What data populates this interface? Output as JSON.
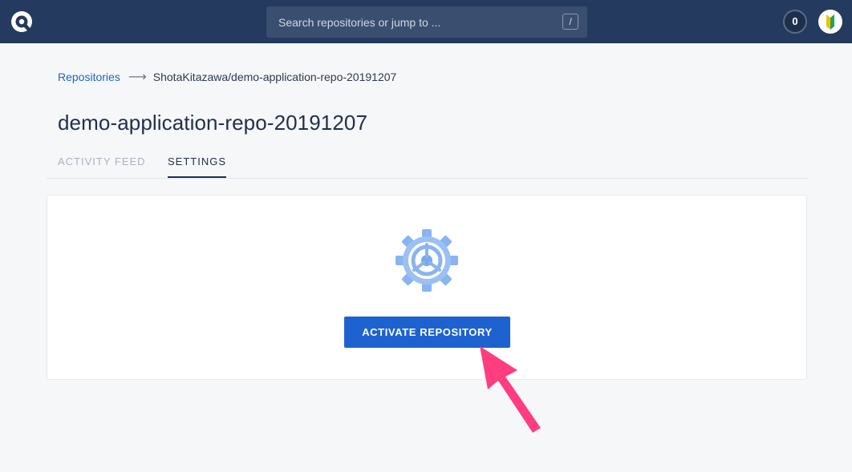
{
  "header": {
    "search": {
      "placeholder": "Search repositories or jump to ...",
      "shortcut": "/"
    },
    "notification_count": "0",
    "icons": {
      "logo": "circleci-logo-icon",
      "avatar": "user-avatar"
    }
  },
  "breadcrumb": {
    "root": "Repositories",
    "separator": "⟶",
    "current": "ShotaKitazawa/demo-application-repo-20191207"
  },
  "page": {
    "title": "demo-application-repo-20191207"
  },
  "tabs": [
    {
      "label": "ACTIVITY FEED",
      "active": false
    },
    {
      "label": "SETTINGS",
      "active": true
    }
  ],
  "card": {
    "icon": "gear-icon",
    "button_label": "ACTIVATE REPOSITORY"
  },
  "colors": {
    "header_bg": "#243a5e",
    "accent": "#1e62d0",
    "link": "#1f63c6",
    "annotation_arrow": "#ff3d7f",
    "gear": "#8ab4f0"
  }
}
